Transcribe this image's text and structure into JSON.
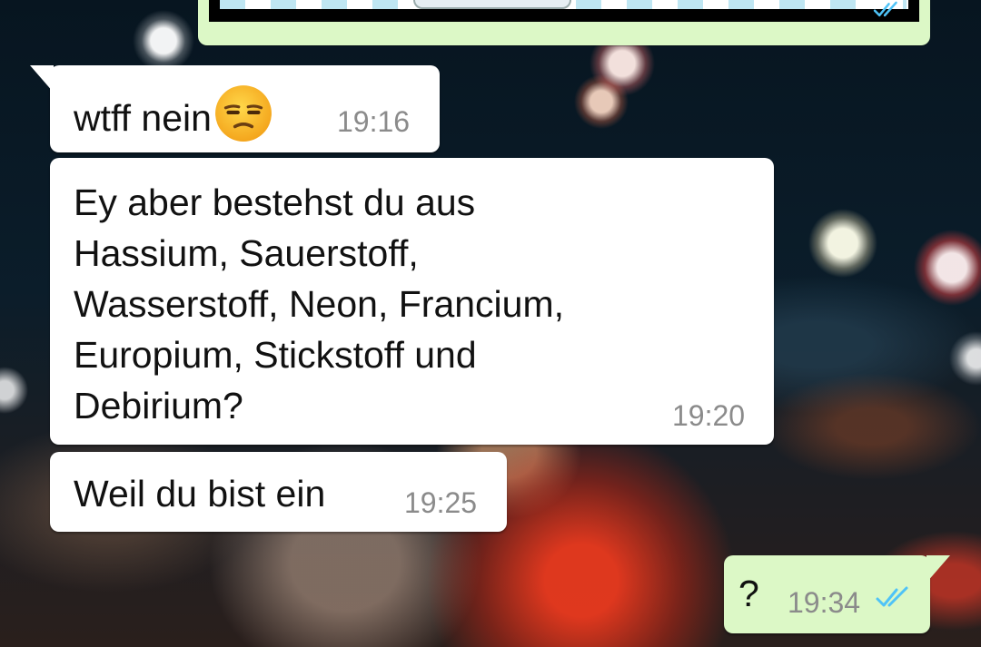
{
  "chat": {
    "messages": [
      {
        "direction": "incoming",
        "text": "wtff nein",
        "emoji": "unamused-face",
        "time": "19:16"
      },
      {
        "direction": "incoming",
        "lines": [
          "Ey aber bestehst du aus",
          "Hassium, Sauerstoff,",
          "Wasserstoff, Neon, Francium,",
          "Europium, Stickstoff und",
          "Debirium?"
        ],
        "time": "19:20"
      },
      {
        "direction": "incoming",
        "text": "Weil du bist ein",
        "time": "19:25"
      },
      {
        "direction": "outgoing",
        "text": "?",
        "time": "19:34",
        "status": "read",
        "status_icon": "double-check-icon"
      }
    ]
  },
  "colors": {
    "incoming_bubble": "#ffffff",
    "outgoing_bubble": "#dcf8c6",
    "timestamp": "#8b8b8b",
    "read_ticks": "#4fc3f7"
  }
}
